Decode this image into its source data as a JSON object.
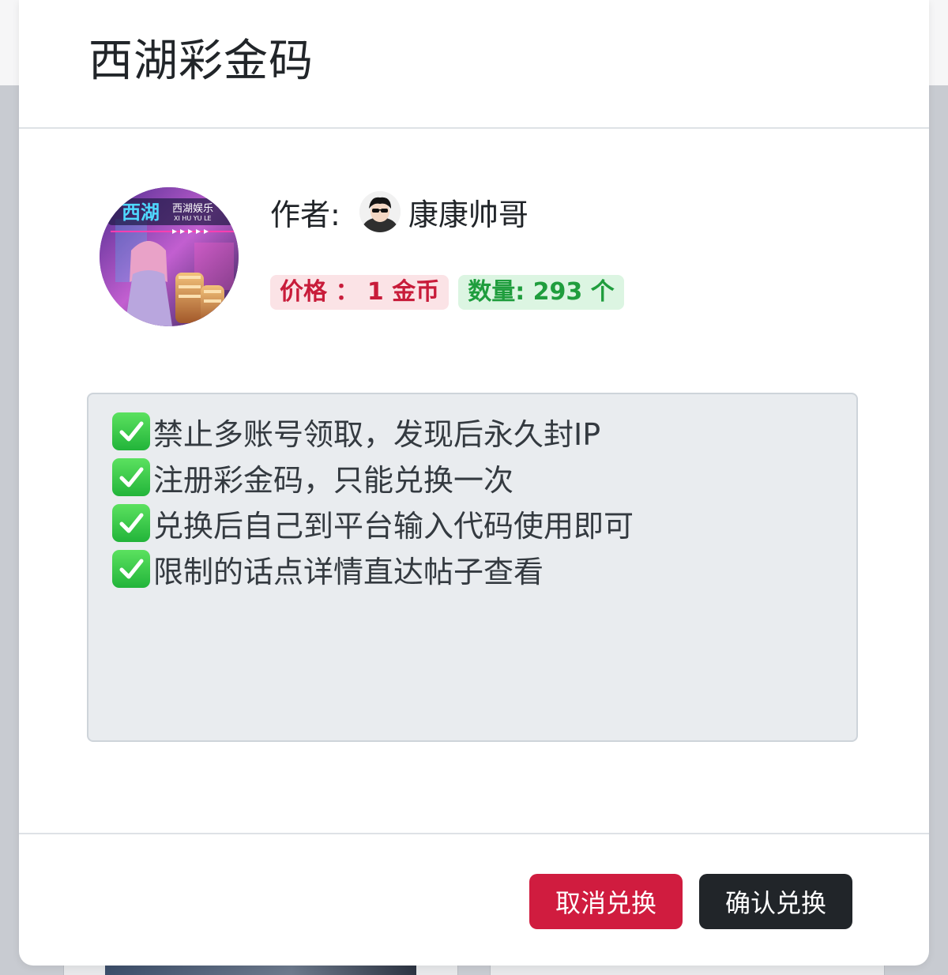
{
  "modal": {
    "title": "西湖彩金码",
    "author_label": "作者:",
    "author_name": "康康帅哥",
    "price_badge": "价格 ： 1 金币",
    "quantity_badge": "数量:   293 个",
    "description_lines": [
      "禁止多账号领取，发现后永久封IP",
      "注册彩金码，只能兑换一次",
      "兑换后自己到平台输入代码使用即可",
      "限制的话点详情直达帖子查看"
    ],
    "logo_text": "西湖",
    "logo_subtext": "西湖娱乐",
    "logo_pinyin": "XI HU YU LE",
    "cancel_button": "取消兑换",
    "confirm_button": "确认兑换"
  },
  "icons": {
    "check": "check-mark-button-icon"
  },
  "colors": {
    "cancel": "#d01c3f",
    "confirm": "#212529",
    "price_text": "#c81c3a",
    "price_bg": "#fbe3e6",
    "qty_text": "#1f9d3d",
    "qty_bg": "#dcf5e2"
  }
}
